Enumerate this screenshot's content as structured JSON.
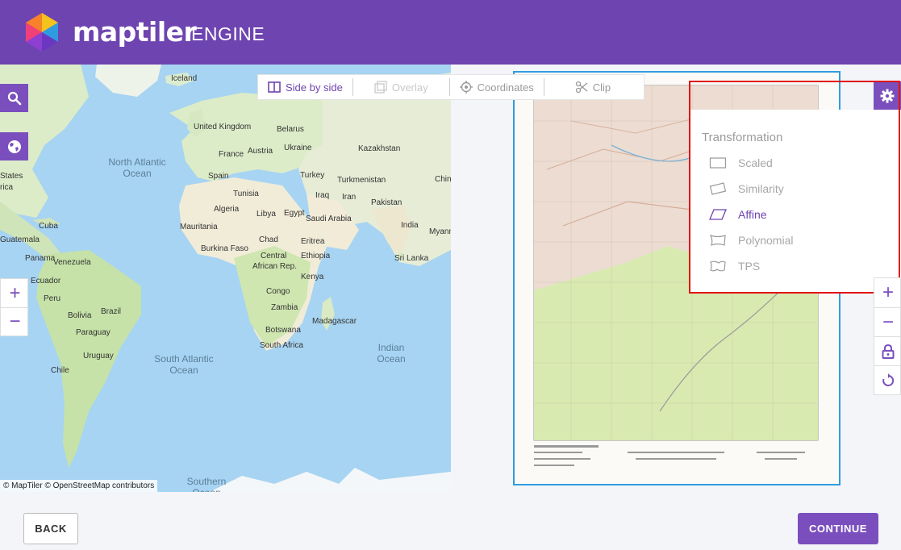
{
  "header": {
    "brand": "maptiler",
    "product": "ENGINE",
    "bg_color": "#6e44b0"
  },
  "toolbar": {
    "items": [
      {
        "label": "Side by side",
        "icon": "side-by-side-icon",
        "state": "active"
      },
      {
        "label": "Overlay",
        "icon": "overlay-icon",
        "state": "disabled"
      },
      {
        "label": "Coordinates",
        "icon": "crosshair-icon",
        "state": "normal"
      },
      {
        "label": "Clip",
        "icon": "scissors-icon",
        "state": "normal"
      }
    ]
  },
  "left_map": {
    "labels": {
      "iceland": "Iceland",
      "united_kingdom": "United Kingdom",
      "belarus": "Belarus",
      "france": "France",
      "austria": "Austria",
      "ukraine": "Ukraine",
      "kazakhstan": "Kazakhstan",
      "spain": "Spain",
      "turkey": "Turkey",
      "turkmenistan": "Turkmenistan",
      "china": "China",
      "tunisia": "Tunisia",
      "iraq": "Iraq",
      "iran": "Iran",
      "algeria": "Algeria",
      "libya": "Libya",
      "egypt": "Egypt",
      "saudi_arabia": "Saudi Arabia",
      "pakistan": "Pakistan",
      "india": "India",
      "myanmar": "Myanm",
      "cuba": "Cuba",
      "mauritania": "Mauritania",
      "chad": "Chad",
      "eritrea": "Eritrea",
      "guatemala": "Guatemala",
      "burkina_faso": "Burkina Faso",
      "panama": "Panama",
      "venezuela": "Venezuela",
      "central": "Central",
      "african_rep": "African Rep.",
      "ethiopia": "Ethiopia",
      "sri_lanka": "Sri Lanka",
      "ecuador": "Ecuador",
      "congo": "Congo",
      "kenya": "Kenya",
      "peru": "Peru",
      "brazil": "Brazil",
      "bolivia": "Bolivia",
      "zambia": "Zambia",
      "paraguay": "Paraguay",
      "madagascar": "Madagascar",
      "botswana": "Botswana",
      "uruguay": "Uruguay",
      "south_africa": "South Africa",
      "chile": "Chile",
      "states": "States",
      "rica": "rica"
    },
    "oceans": {
      "north_atlantic": "North Atlantic\nOcean",
      "south_atlantic": "South Atlantic\nOcean",
      "indian": "Indian\nOcean",
      "southern": "Southern\nOcean"
    },
    "attribution": "© MapTiler © OpenStreetMap contributors",
    "search_icon": "search-icon",
    "globe_icon": "globe-icon",
    "zoom_in": "+",
    "zoom_out": "−"
  },
  "transformation": {
    "title": "Transformation",
    "options": [
      {
        "label": "Scaled",
        "icon": "rectangle-icon",
        "selected": false
      },
      {
        "label": "Similarity",
        "icon": "rotated-rectangle-icon",
        "selected": false
      },
      {
        "label": "Affine",
        "icon": "parallelogram-icon",
        "selected": true
      },
      {
        "label": "Polynomial",
        "icon": "curved-shape-icon",
        "selected": false
      },
      {
        "label": "TPS",
        "icon": "warped-shape-icon",
        "selected": false
      }
    ]
  },
  "right_controls": {
    "zoom_in": "+",
    "zoom_out": "−"
  },
  "footer": {
    "back": "BACK",
    "continue": "CONTINUE"
  },
  "colors": {
    "accent": "#7a4fbd",
    "highlight_border": "#e01515",
    "scan_border": "#2f9ce0",
    "water": "#a7d4f2",
    "land": "#f2efe3",
    "vegetation": "#bfe3a3"
  }
}
